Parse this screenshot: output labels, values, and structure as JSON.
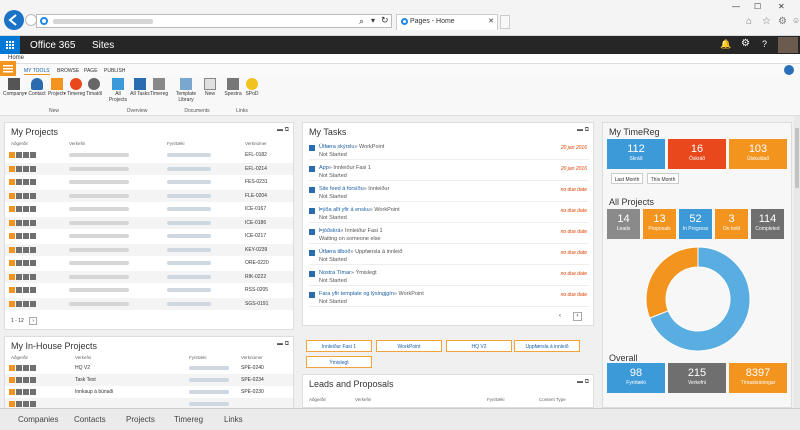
{
  "browser": {
    "tab_title": "Pages - Home"
  },
  "suite": {
    "app": "Office 365",
    "section": "Sites"
  },
  "breadcrumb": "Home",
  "ribbon": {
    "tabs": [
      "MY TOOLS",
      "BROWSE",
      "PAGE",
      "PUBLISH"
    ],
    "buttons": [
      {
        "label": "Company"
      },
      {
        "label": "Contact"
      },
      {
        "label": "Project"
      },
      {
        "label": "Timereg"
      },
      {
        "label": "Timatöl"
      },
      {
        "label": "All Projects"
      },
      {
        "label": "All Tasks"
      },
      {
        "label": "Timereg"
      },
      {
        "label": "Template Library"
      },
      {
        "label": "New"
      },
      {
        "label": "Spestra"
      },
      {
        "label": "SPoD"
      }
    ],
    "groups": [
      "New",
      "Overview",
      "Documents",
      "Links"
    ]
  },
  "my_projects": {
    "title": "My Projects",
    "headers": [
      "Aðgerðir",
      "Verkefni",
      "Fyrirtæki",
      "Verknúmer"
    ],
    "codes": [
      "EFL-0182",
      "EFL-0214",
      "FES-0231",
      "FLE-0204",
      "ICE-0167",
      "ICE-0186",
      "ICE-0217",
      "KEY-0239",
      "ORE-0220",
      "RIK-0222",
      "RSS-0205",
      "SGS-0191"
    ],
    "pager": "1 - 12"
  },
  "inhouse": {
    "title": "My In-House Projects",
    "headers": [
      "Aðgerðir",
      "Verkefni",
      "Fyrirtæki",
      "Verknúmer"
    ],
    "rows": [
      {
        "name": "HQ V2",
        "code": "SPE-0240"
      },
      {
        "name": "Task Test",
        "code": "SPE-0234"
      },
      {
        "name": "Innkaup á búnaði",
        "code": "SPE-0230"
      },
      {
        "name": "",
        "code": ""
      }
    ]
  },
  "tasks": {
    "title": "My Tasks",
    "items": [
      {
        "title": "Útfæra skýrslu",
        "proj": "» WorkPoint",
        "status": "Not Started",
        "date": "20 jan 2016"
      },
      {
        "title": "App",
        "proj": "» Innleiður Fasi 1",
        "status": "Not Started",
        "date": "20 jan 2016"
      },
      {
        "title": "Site feed á forsíðu",
        "proj": "» Innleiður",
        "status": "Not Started",
        "date": "no due date"
      },
      {
        "title": "Þýða allt yfir á ensku",
        "proj": "» WorkPoint",
        "status": "Not Started",
        "date": "no due date"
      },
      {
        "title": "Þjóðskrá",
        "proj": "» Innleiður Fasi 1",
        "status": "Waiting on someone else",
        "date": "no due date"
      },
      {
        "title": "Útfæra tilboð",
        "proj": "» Uppfærsla á innleið",
        "status": "Not Started",
        "date": "no due date"
      },
      {
        "title": "Nostra Tímar",
        "proj": "» Ýmislegt",
        "status": "Not Started",
        "date": "no due date"
      },
      {
        "title": "Fara yfir template og lýsingjgín",
        "proj": "» WorkPoint",
        "status": "Not Started",
        "date": "no due date"
      }
    ],
    "project_buttons": [
      "Innleiður Fasi 1",
      "WorkPoint",
      "HQ V2",
      "Uppfærsla á innleið",
      "Ýmislegt"
    ]
  },
  "leads": {
    "title": "Leads and Proposals",
    "headers": [
      "Aðgerðir",
      "Verkefni",
      "Fyrirtæki",
      "Content Type"
    ]
  },
  "timereg": {
    "title": "My TimeReg",
    "tiles": [
      {
        "value": "112",
        "label": "Skráð",
        "color": "#3d9ad8"
      },
      {
        "value": "16",
        "label": "Óskráð",
        "color": "#e8481c"
      },
      {
        "value": "103",
        "label": "Útskuldað",
        "color": "#f2941e"
      }
    ],
    "buttons": [
      "Last Month",
      "This Month"
    ]
  },
  "all_projects": {
    "title": "All Projects",
    "tiles": [
      {
        "value": "14",
        "label": "Leads",
        "color": "#8a8a8a"
      },
      {
        "value": "13",
        "label": "Proposals",
        "color": "#f2941e"
      },
      {
        "value": "52",
        "label": "In Progress",
        "color": "#3d9ad8"
      },
      {
        "value": "3",
        "label": "On hold",
        "color": "#f2941e"
      },
      {
        "value": "114",
        "label": "Completed",
        "color": "#6f6f6f"
      }
    ],
    "donut": [
      {
        "share": 0.69,
        "color": "#5aade0"
      },
      {
        "share": 0.31,
        "color": "#f2941e"
      }
    ]
  },
  "overall": {
    "title": "Overall",
    "tiles": [
      {
        "value": "98",
        "label": "Fyrirtæki",
        "color": "#3d9ad8"
      },
      {
        "value": "215",
        "label": "Verkefni",
        "color": "#6f6f6f"
      },
      {
        "value": "8397",
        "label": "Tímaskráningar",
        "color": "#f2941e"
      }
    ]
  },
  "bottom_nav": [
    "Companies",
    "Contacts",
    "Projects",
    "Timereg",
    "Links"
  ]
}
